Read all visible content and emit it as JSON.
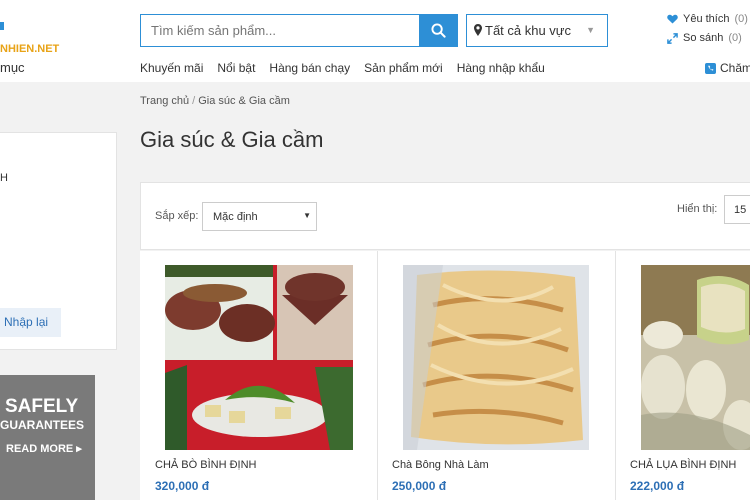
{
  "header": {
    "logo_text": "NHIEN.NET",
    "category_label": "mục",
    "search_placeholder": "Tìm kiếm sản phẩm...",
    "region_label": "Tất cả khu vực",
    "favorites_label": "Yêu thích",
    "favorites_count": "(0)",
    "compare_label": "So sánh",
    "compare_count": "(0)",
    "nav": [
      "Khuyến mãi",
      "Nổi bật",
      "Hàng bán chạy",
      "Sản phẩm mới",
      "Hàng nhập khẩu"
    ],
    "support_label": "Chăm"
  },
  "breadcrumb": {
    "home": "Trang chủ",
    "separator": "/",
    "current": "Gia súc & Gia cầm"
  },
  "page_title": "Gia súc & Gia cầm",
  "sidebar": {
    "heading_fragment": "H",
    "reset_label": "Nhập lại",
    "banner_line1": "SAFELY",
    "banner_line2": "GUARANTEES",
    "banner_cta": "READ MORE ▸"
  },
  "toolbar": {
    "sort_label": "Sắp xếp:",
    "sort_value": "Mặc định",
    "show_label": "Hiển thị:",
    "show_value": "15"
  },
  "products": [
    {
      "name": "CHẢ BÒ BÌNH ĐỊNH",
      "price": "320,000 đ"
    },
    {
      "name": "Chà Bông Nhà Làm",
      "price": "250,000 đ"
    },
    {
      "name": "CHẢ LỤA BÌNH ĐỊNH",
      "price": "222,000 đ"
    }
  ],
  "colors": {
    "accent": "#2d8fd6",
    "price": "#2d6fb5",
    "logo": "#e8a317"
  }
}
